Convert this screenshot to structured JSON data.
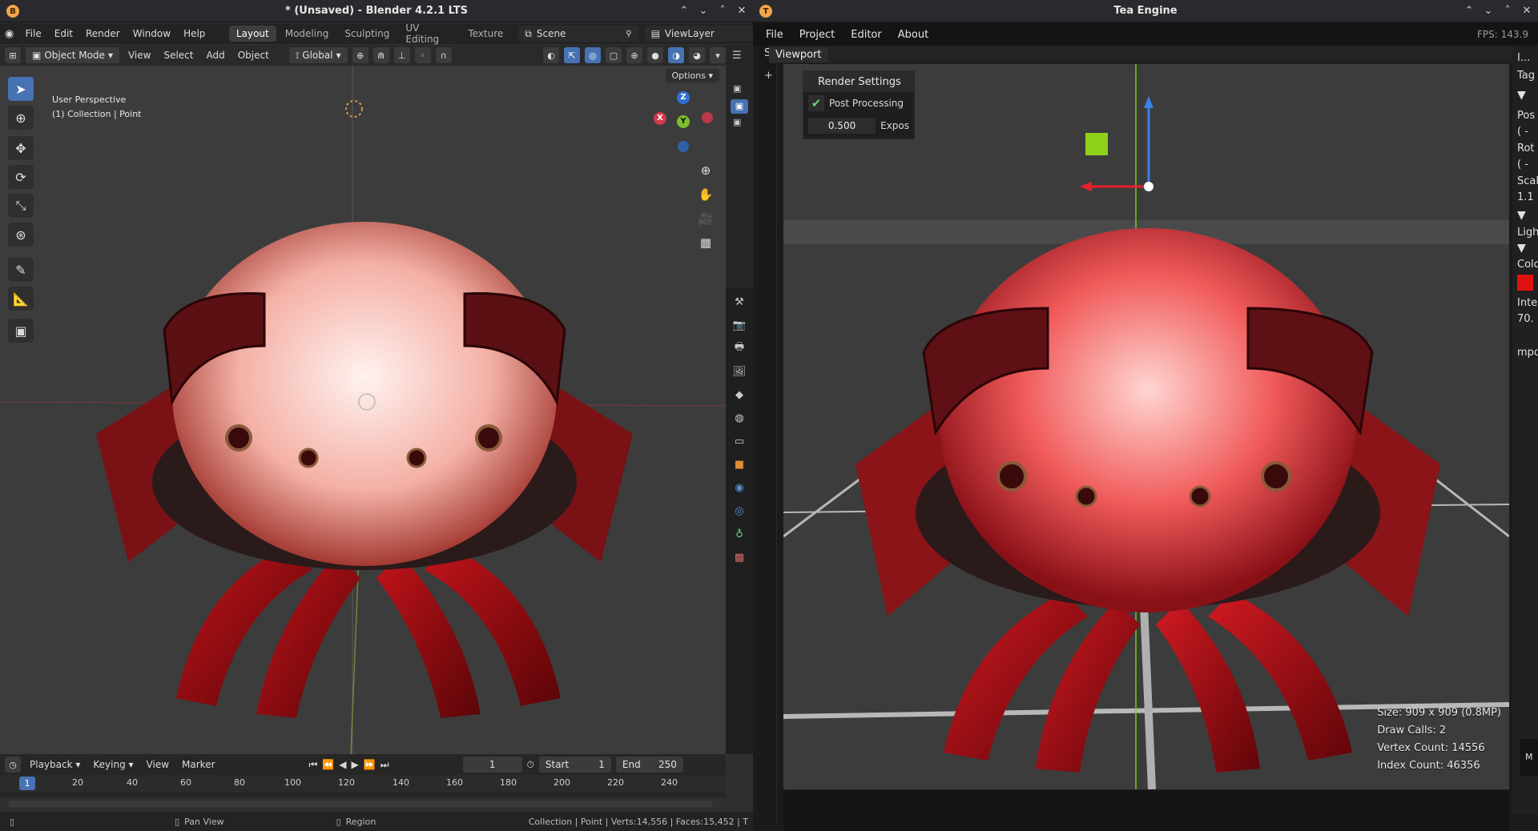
{
  "blender": {
    "title": "* (Unsaved) - Blender 4.2.1 LTS",
    "menu": [
      "File",
      "Edit",
      "Render",
      "Window",
      "Help"
    ],
    "workspaces": [
      "Layout",
      "Modeling",
      "Sculpting",
      "UV Editing",
      "Texture"
    ],
    "active_workspace": "Layout",
    "scene": "Scene",
    "view_layer": "ViewLayer",
    "header": {
      "mode": "Object Mode",
      "menus": [
        "View",
        "Select",
        "Add",
        "Object"
      ],
      "orientation": "Global"
    },
    "viewport": {
      "options_label": "Options",
      "perspective": "User Perspective",
      "collection": "(1) Collection | Point"
    },
    "gizmo": {
      "x": "X",
      "y": "Y",
      "z": "Z"
    },
    "timeline": {
      "menus": [
        "Playback",
        "Keying",
        "View",
        "Marker"
      ],
      "current_frame": "1",
      "start_label": "Start",
      "start": "1",
      "end_label": "End",
      "end": "250",
      "ticks": [
        "1",
        "20",
        "40",
        "60",
        "80",
        "100",
        "120",
        "140",
        "160",
        "180",
        "200",
        "220",
        "240"
      ]
    },
    "status": {
      "pan": "Pan View",
      "region": "Region",
      "stats": "Collection | Point | Verts:14,556 | Faces:15,452 | T"
    }
  },
  "tea": {
    "title": "Tea Engine",
    "menu": [
      "File",
      "Project",
      "Editor",
      "About"
    ],
    "fps": "FPS: 143.9",
    "tab": "Viewport",
    "side_letter": "S",
    "render_settings": {
      "title": "Render Settings",
      "post_processing": "Post Processing",
      "exposure_value": "0.500",
      "exposure_label": "Expos"
    },
    "stats": {
      "size": "Size: 909 x 909 (0.8MP)",
      "draw_calls": "Draw Calls: 2",
      "vertex": "Vertex Count: 14556",
      "index": "Index Count: 46356"
    },
    "panel": {
      "top": "I...",
      "tag": "Tag",
      "pos": "Pos",
      "pos_val": "( -",
      "rot": "Rot",
      "rot_val": "( -",
      "scale": "Scal",
      "scale_val": "1.1",
      "light": "Ligh",
      "color": "Colo",
      "intensity": "Inte",
      "intensity_val": "70.",
      "impo": "mpo",
      "m": "M"
    },
    "light_color": "#e01010"
  }
}
